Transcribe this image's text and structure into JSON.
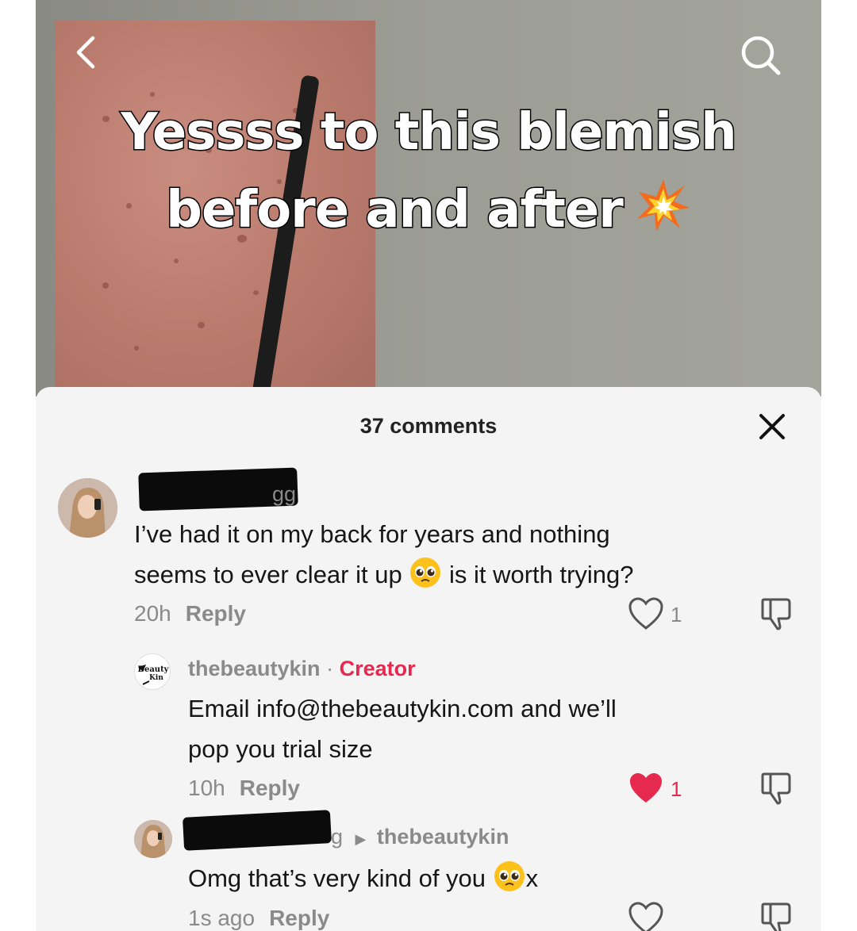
{
  "video": {
    "caption_line1": "Yessss to this blemish",
    "caption_line2": "before and after",
    "caption_emoji": "collision-icon"
  },
  "header_icons": [
    "back-arrow-icon",
    "search-icon"
  ],
  "sheet": {
    "title": "37 comments",
    "close_icon": "close-icon"
  },
  "comments": [
    {
      "username_fragment": "gg",
      "text_line1": "I’ve had it on my back for years and nothing",
      "text_line2_a": "seems to ever clear it up",
      "text_line2_b": "is it worth trying?",
      "emoji": "pleading-face-icon",
      "time": "20h",
      "reply_label": "Reply",
      "likes": "1",
      "liked": false
    },
    {
      "username": "thebeautykin",
      "separator": "·",
      "badge": "Creator",
      "avatar_text_1": "Beauty",
      "avatar_text_2": "Kin",
      "text_line1": "Email info@thebeautykin.com and we’ll",
      "text_line2": "pop you trial size",
      "time": "10h",
      "reply_label": "Reply",
      "likes": "1",
      "liked": true
    },
    {
      "username_fragment": "g",
      "reply_to": "thebeautykin",
      "text_a": "Omg that’s very kind of you",
      "text_b": "x",
      "emoji": "pleading-face-icon",
      "time": "1s ago",
      "reply_label": "Reply",
      "likes": "",
      "liked": false
    }
  ],
  "colors": {
    "accent_red": "#e5294f",
    "meta_gray": "#8a8a8a",
    "sheet_bg": "#f4f4f4"
  }
}
